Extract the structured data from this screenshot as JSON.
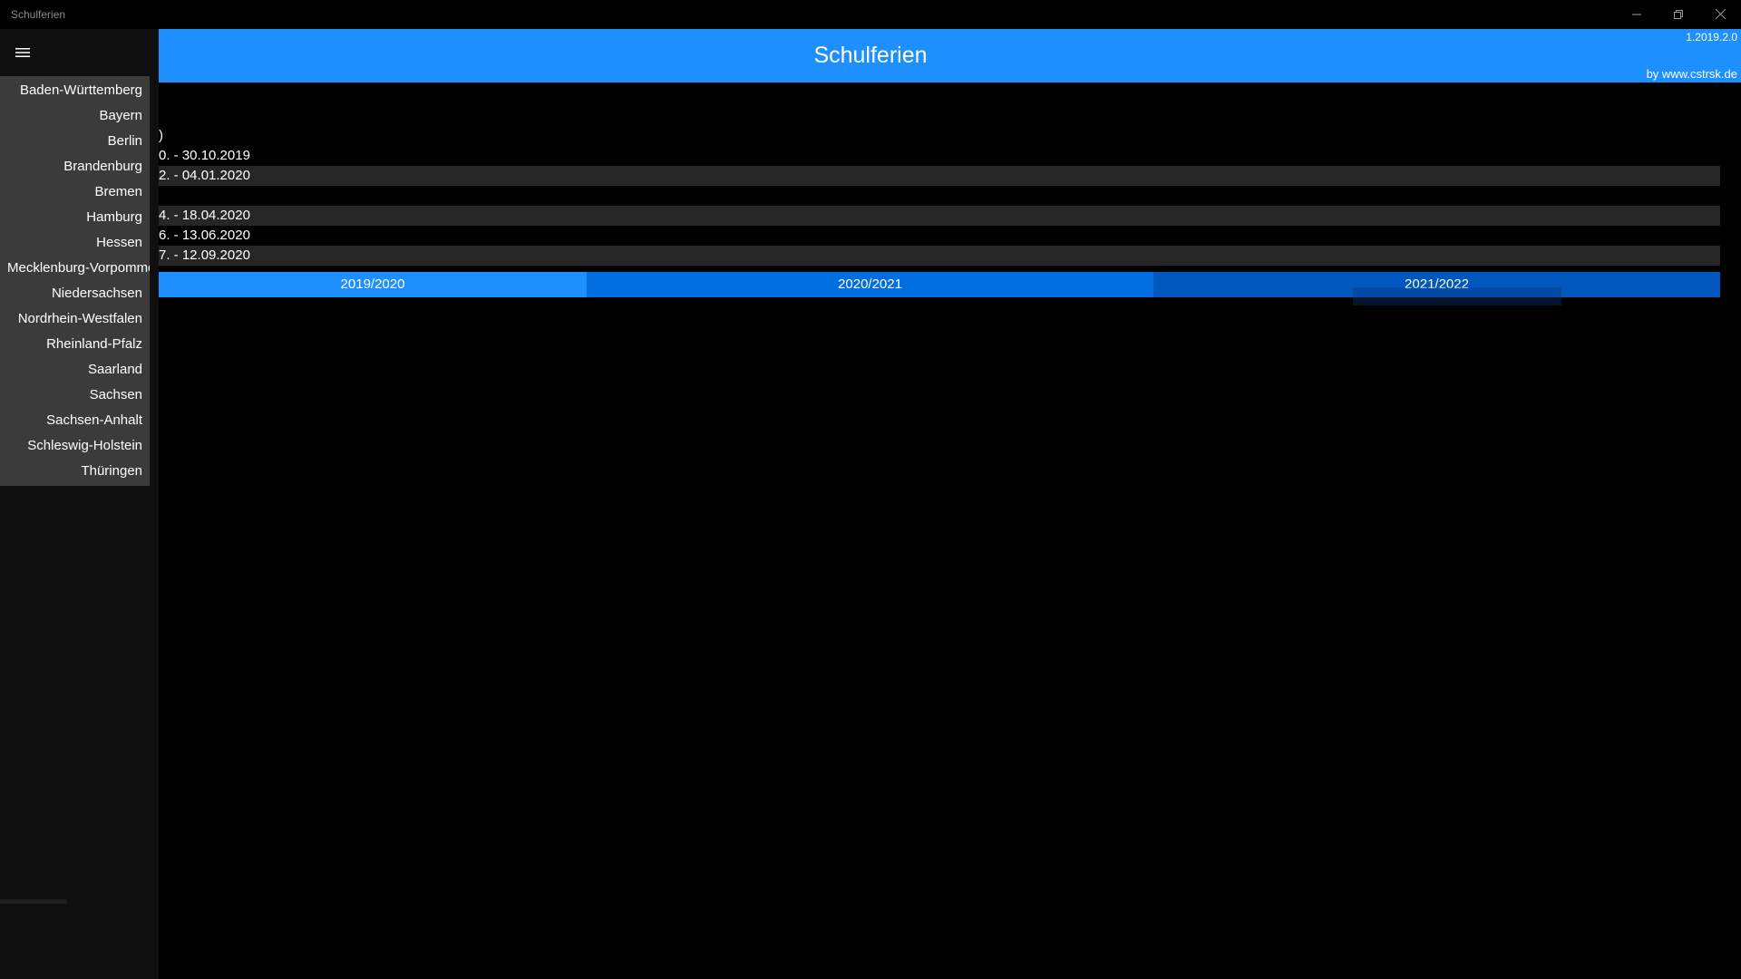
{
  "window": {
    "title": "Schulferien",
    "minimize_icon": "minimize-icon",
    "maximize_icon": "restore-icon",
    "close_icon": "close-icon"
  },
  "pane": {
    "menu_icon": "hamburger-menu-icon",
    "states": [
      "Baden-Württemberg",
      "Bayern",
      "Berlin",
      "Brandenburg",
      "Bremen",
      "Hamburg",
      "Hessen",
      "Mecklenburg-Vorpommern",
      "Niedersachsen",
      "Nordrhein-Westfalen",
      "Rheinland-Pfalz",
      "Saarland",
      "Sachsen",
      "Sachsen-Anhalt",
      "Schleswig-Holstein",
      "Thüringen"
    ]
  },
  "header": {
    "title": "Schulferien",
    "version": "1.2019.2.0",
    "by": "by www.cstrsk.de"
  },
  "holidays": [
    ")",
    "0. - 30.10.2019",
    "2. - 04.01.2020",
    "",
    "4. - 18.04.2020",
    "6. - 13.06.2020",
    "7. - 12.09.2020"
  ],
  "tabs": [
    "2019/2020",
    "2020/2021",
    "2021/2022"
  ],
  "colors": {
    "accent": "#1e8fff",
    "tab_mid": "#006ee0",
    "tab_dark": "#0057be",
    "pane_list": "#3b3b3b",
    "row_alt": "#262626"
  }
}
